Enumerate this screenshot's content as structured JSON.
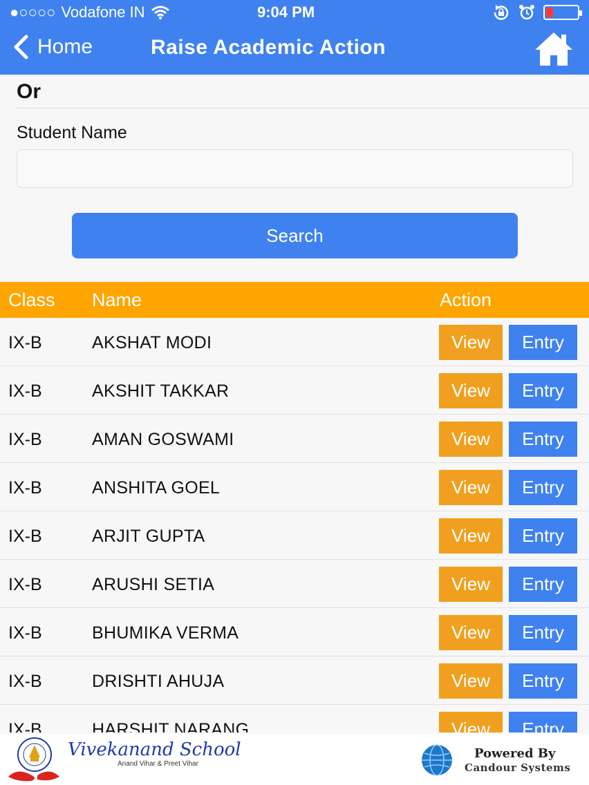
{
  "status_bar": {
    "signal": "●○○○○",
    "carrier": "Vodafone IN",
    "time": "9:04 PM"
  },
  "nav": {
    "back_label": "Home",
    "title": "Raise Academic Action"
  },
  "form": {
    "or_label": "Or",
    "student_name_label": "Student Name",
    "student_name_value": "",
    "search_label": "Search"
  },
  "table": {
    "headers": {
      "class": "Class",
      "name": "Name",
      "action": "Action"
    },
    "view_label": "View",
    "entry_label": "Entry",
    "rows": [
      {
        "class": "IX-B",
        "name": "AKSHAT MODI"
      },
      {
        "class": "IX-B",
        "name": "AKSHIT TAKKAR"
      },
      {
        "class": "IX-B",
        "name": "AMAN GOSWAMI"
      },
      {
        "class": "IX-B",
        "name": "ANSHITA GOEL"
      },
      {
        "class": "IX-B",
        "name": "ARJIT GUPTA"
      },
      {
        "class": "IX-B",
        "name": "ARUSHI SETIA"
      },
      {
        "class": "IX-B",
        "name": "BHUMIKA VERMA"
      },
      {
        "class": "IX-B",
        "name": "DRISHTI AHUJA"
      },
      {
        "class": "IX-B",
        "name": "HARSHIT NARANG"
      }
    ]
  },
  "footer": {
    "school_name": "Vivekanand School",
    "school_subtitle": "Anand Vihar & Preet Vihar",
    "powered_by": "Powered By",
    "company": "Candour Systems"
  },
  "colors": {
    "primary": "#3f82ef",
    "header_orange": "#ffa500",
    "view_button": "#f0a01e",
    "battery_low": "#ff3b30"
  },
  "icons": {
    "back": "chevron-left-icon",
    "home": "home-icon",
    "wifi": "wifi-icon",
    "rotation_lock": "rotation-lock-icon",
    "alarm": "alarm-icon",
    "battery": "battery-icon"
  }
}
